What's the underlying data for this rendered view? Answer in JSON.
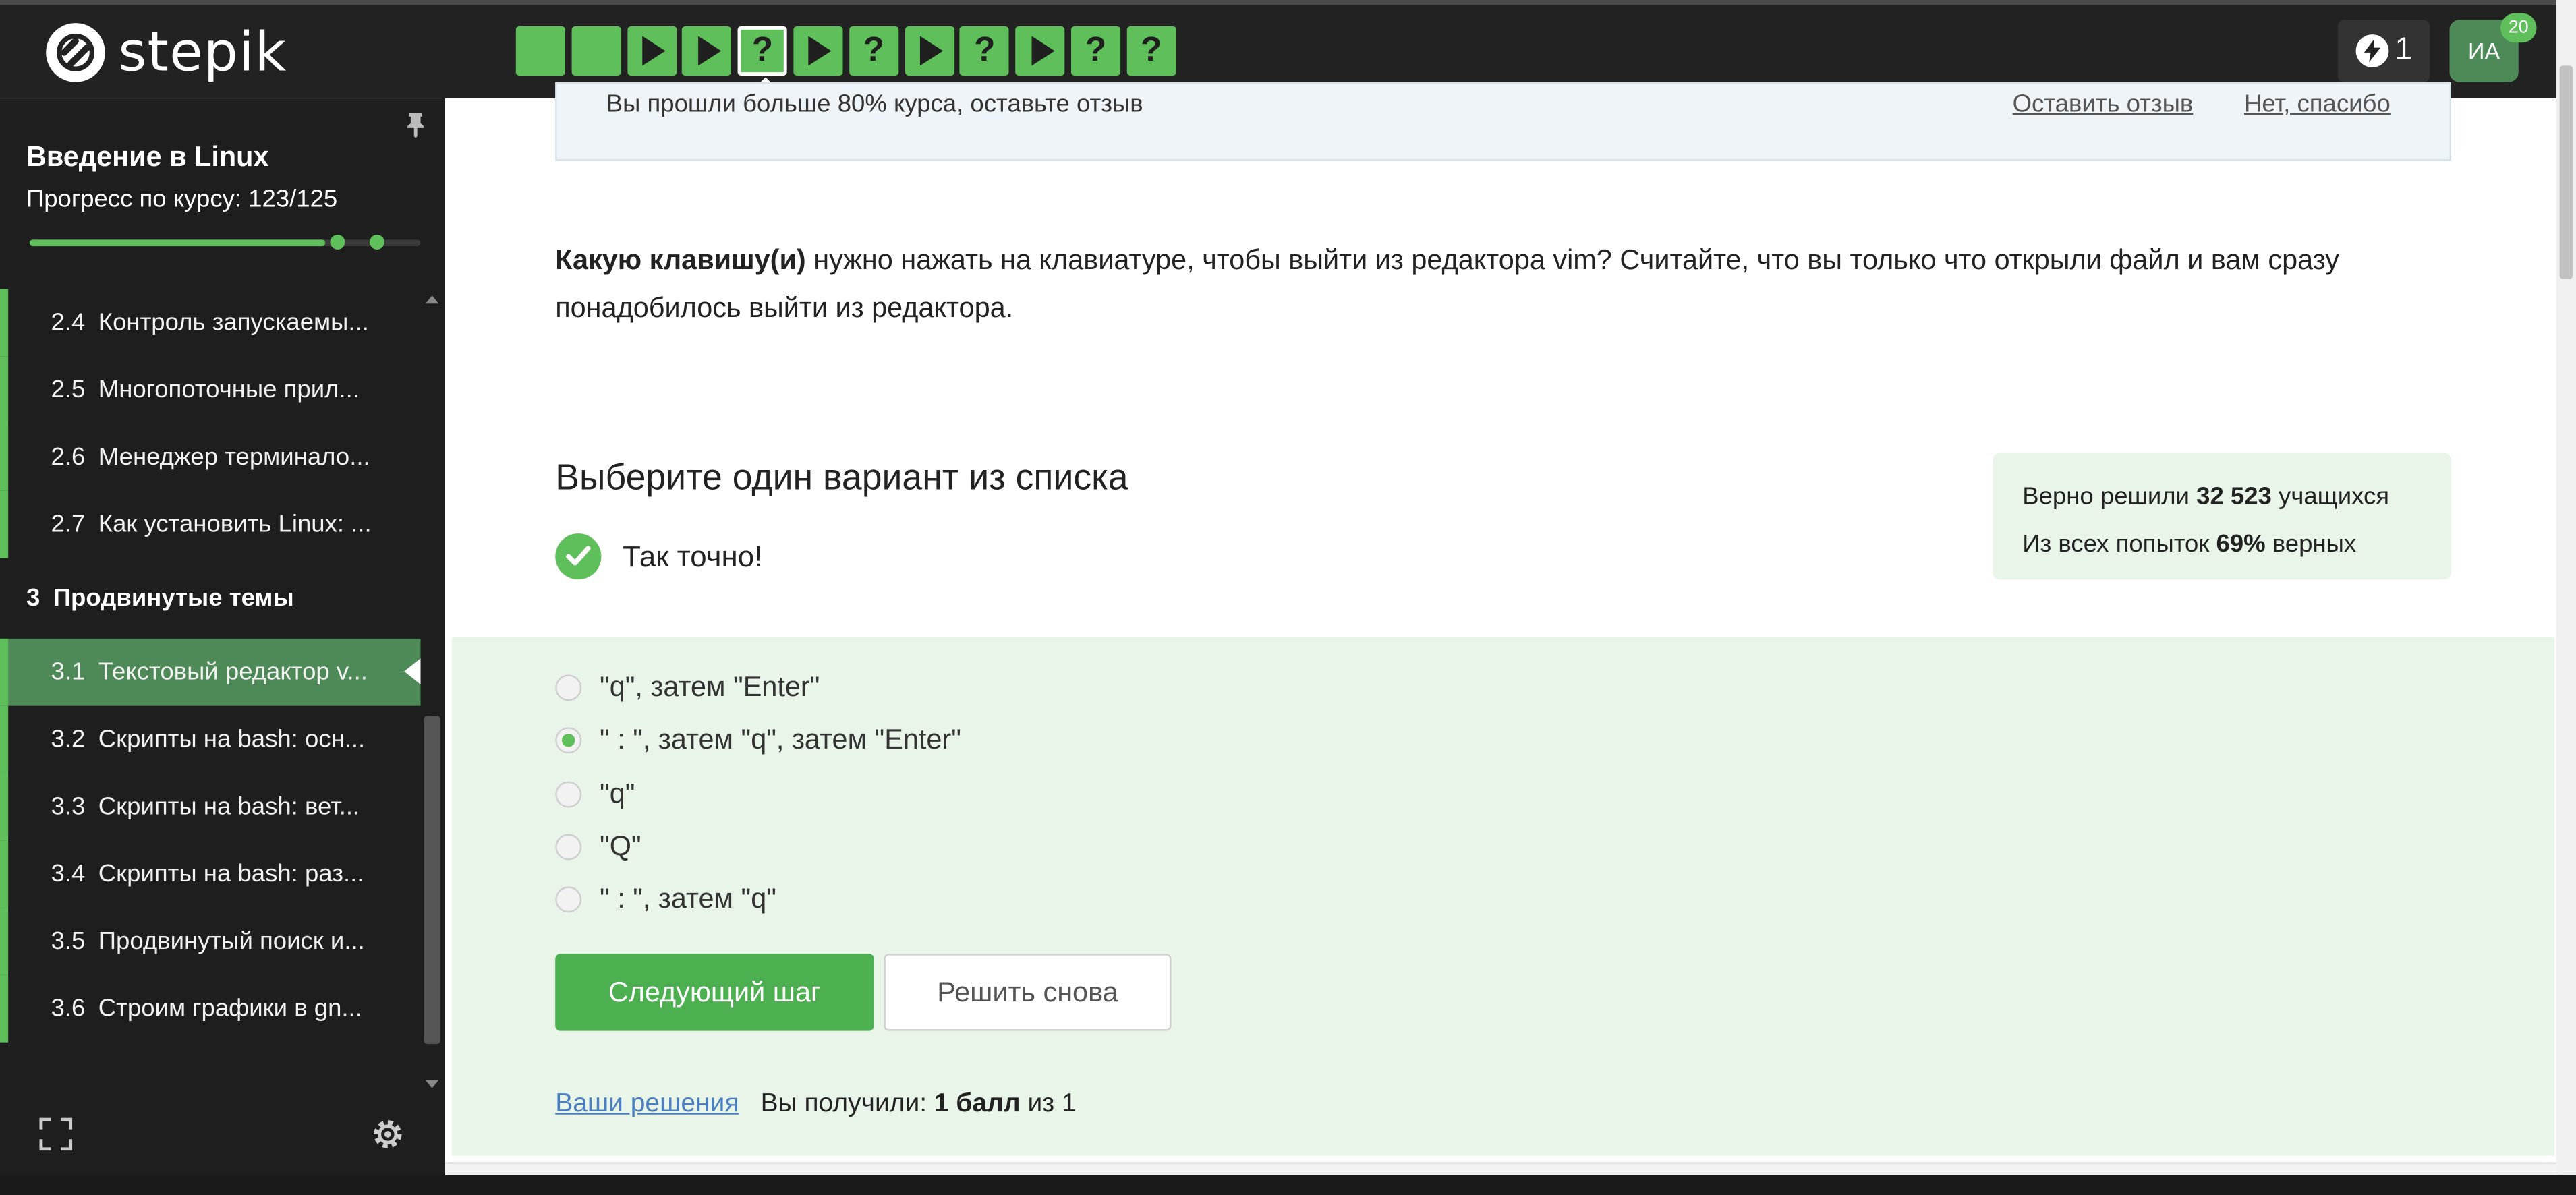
{
  "brand": {
    "name": "stepik"
  },
  "topbar": {
    "steps": [
      {
        "kind": "text"
      },
      {
        "kind": "text"
      },
      {
        "kind": "video"
      },
      {
        "kind": "video"
      },
      {
        "kind": "quiz",
        "current": true,
        "label": "?"
      },
      {
        "kind": "video"
      },
      {
        "kind": "quiz",
        "label": "?"
      },
      {
        "kind": "video"
      },
      {
        "kind": "quiz",
        "label": "?"
      },
      {
        "kind": "video"
      },
      {
        "kind": "quiz",
        "label": "?"
      },
      {
        "kind": "quiz",
        "label": "?"
      }
    ],
    "streak_count": "1",
    "avatar_initials": "ИА",
    "notifications_count": "20"
  },
  "sidebar": {
    "course_title": "Введение в Linux",
    "progress_text": "Прогресс по курсу:  123/125",
    "progress_fraction": 0.984,
    "items": [
      {
        "num": "2.4",
        "label": "Контроль запускаемы..."
      },
      {
        "num": "2.5",
        "label": "Многопоточные прил..."
      },
      {
        "num": "2.6",
        "label": "Менеджер терминало..."
      },
      {
        "num": "2.7",
        "label": "Как установить Linux: ..."
      }
    ],
    "section": {
      "num": "3",
      "label": "Продвинутые темы"
    },
    "section_items": [
      {
        "num": "3.1",
        "label": "Текстовый редактор v...",
        "active": true
      },
      {
        "num": "3.2",
        "label": "Скрипты на bash: осн..."
      },
      {
        "num": "3.3",
        "label": "Скрипты на bash: вет..."
      },
      {
        "num": "3.4",
        "label": "Скрипты на bash: раз..."
      },
      {
        "num": "3.5",
        "label": "Продвинутый поиск и..."
      },
      {
        "num": "3.6",
        "label": "Строим графики в gn..."
      }
    ]
  },
  "notice": {
    "text": "Вы прошли больше 80% курса, оставьте отзыв",
    "leave_review": "Оставить отзыв",
    "no_thanks": "Нет, спасибо"
  },
  "question": {
    "bold": "Какую клавишу(и)",
    "rest": " нужно нажать на клавиатуре, чтобы выйти из редактора vim? Считайте, что вы только что открыли файл и вам сразу понадобилось выйти из редактора."
  },
  "quiz": {
    "title": "Выберите один вариант из списка",
    "result": "Так точно!",
    "stats_line1_prefix": "Верно решили ",
    "stats_solved": "32 523",
    "stats_line1_suffix": " учащихся",
    "stats_line2_prefix": "Из всех попыток ",
    "stats_percent": "69%",
    "stats_line2_suffix": " верных",
    "options": [
      {
        "label": "\"q\", затем \"Enter\"",
        "selected": false
      },
      {
        "label": "\" : \", затем \"q\", затем \"Enter\"",
        "selected": true
      },
      {
        "label": "\"q\"",
        "selected": false
      },
      {
        "label": "\"Q\"",
        "selected": false
      },
      {
        "label": "\" : \", затем \"q\"",
        "selected": false
      }
    ],
    "next_button": "Следующий шаг",
    "retry_button": "Решить снова",
    "solutions_link": "Ваши решения",
    "score_prefix": "Вы получили: ",
    "score_value": "1 балл",
    "score_suffix": " из 1"
  },
  "colors": {
    "accent": "#5fbf5a",
    "topbar_bg": "#222222",
    "sidebar_bg": "#1e1e1e",
    "answer_bg": "#e8f5e8",
    "link": "#4a7fc1"
  }
}
